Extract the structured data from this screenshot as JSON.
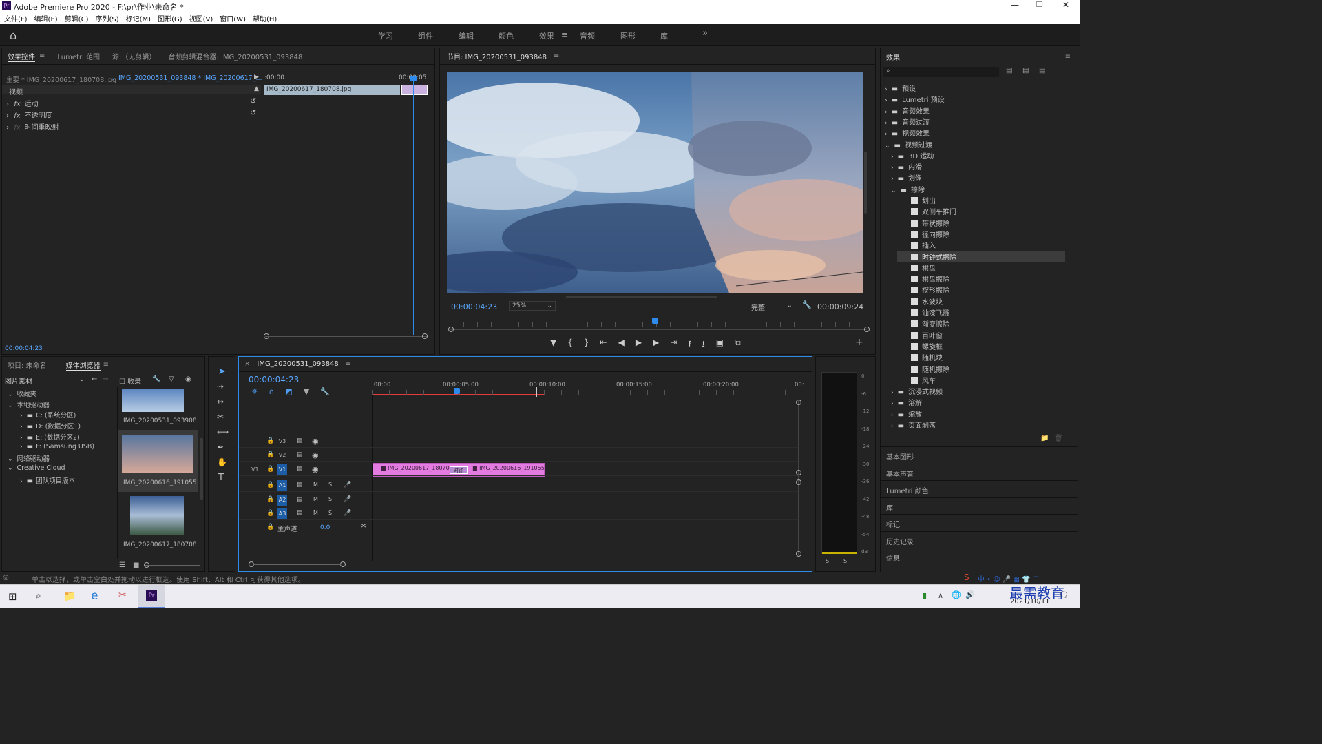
{
  "window": {
    "title": "Adobe Premiere Pro 2020 - F:\\pr\\作业\\未命名 *",
    "app_icon": "Pr"
  },
  "menu": [
    "文件(F)",
    "编辑(E)",
    "剪辑(C)",
    "序列(S)",
    "标记(M)",
    "图形(G)",
    "视图(V)",
    "窗口(W)",
    "帮助(H)"
  ],
  "workspaces": [
    "学习",
    "组件",
    "编辑",
    "颜色",
    "效果",
    "音频",
    "图形",
    "库"
  ],
  "workspace_active": "效果",
  "effect_controls": {
    "tabs": [
      "效果控件",
      "Lumetri 范围",
      "源:（无剪辑）",
      "音频剪辑混合器: IMG_20200531_093848"
    ],
    "master": "主要 * IMG_20200617_180708.jpg",
    "sequence": "IMG_20200531_093848 * IMG_20200617_...",
    "video_label": "视频",
    "items": [
      "运动",
      "不透明度",
      "时间重映射"
    ],
    "time_start": ":00:00",
    "time_end": "00:00:05",
    "clip": "IMG_20200617_180708.jpg",
    "timecode": "00:00:04:23"
  },
  "program": {
    "title": "节目: IMG_20200531_093848",
    "timecode": "00:00:04:23",
    "zoom": "25%",
    "quality": "完整",
    "duration": "00:00:09:24"
  },
  "effects": {
    "title": "效果",
    "tree": [
      {
        "label": "预设",
        "level": 0,
        "type": "folder-special"
      },
      {
        "label": "Lumetri 预设",
        "level": 0,
        "type": "folder-special"
      },
      {
        "label": "音频效果",
        "level": 0,
        "type": "folder"
      },
      {
        "label": "音频过渡",
        "level": 0,
        "type": "folder"
      },
      {
        "label": "视频效果",
        "level": 0,
        "type": "folder"
      },
      {
        "label": "视频过渡",
        "level": 0,
        "type": "folder",
        "open": true
      },
      {
        "label": "3D 运动",
        "level": 1,
        "type": "folder"
      },
      {
        "label": "内滑",
        "level": 1,
        "type": "folder"
      },
      {
        "label": "划像",
        "level": 1,
        "type": "folder"
      },
      {
        "label": "擦除",
        "level": 1,
        "type": "folder",
        "open": true
      },
      {
        "label": "划出",
        "level": 2,
        "type": "fx"
      },
      {
        "label": "双侧平推门",
        "level": 2,
        "type": "fx"
      },
      {
        "label": "带状擦除",
        "level": 2,
        "type": "fx"
      },
      {
        "label": "径向擦除",
        "level": 2,
        "type": "fx"
      },
      {
        "label": "插入",
        "level": 2,
        "type": "fx"
      },
      {
        "label": "时钟式擦除",
        "level": 2,
        "type": "fx",
        "selected": true
      },
      {
        "label": "棋盘",
        "level": 2,
        "type": "fx"
      },
      {
        "label": "棋盘擦除",
        "level": 2,
        "type": "fx"
      },
      {
        "label": "楔形擦除",
        "level": 2,
        "type": "fx"
      },
      {
        "label": "水波块",
        "level": 2,
        "type": "fx"
      },
      {
        "label": "油漆飞溅",
        "level": 2,
        "type": "fx"
      },
      {
        "label": "渐变擦除",
        "level": 2,
        "type": "fx"
      },
      {
        "label": "百叶窗",
        "level": 2,
        "type": "fx"
      },
      {
        "label": "螺旋框",
        "level": 2,
        "type": "fx"
      },
      {
        "label": "随机块",
        "level": 2,
        "type": "fx"
      },
      {
        "label": "随机擦除",
        "level": 2,
        "type": "fx"
      },
      {
        "label": "风车",
        "level": 2,
        "type": "fx"
      },
      {
        "label": "沉浸式视频",
        "level": 1,
        "type": "folder"
      },
      {
        "label": "溶解",
        "level": 1,
        "type": "folder"
      },
      {
        "label": "缩放",
        "level": 1,
        "type": "folder"
      },
      {
        "label": "页面剥落",
        "level": 1,
        "type": "folder"
      }
    ],
    "side_panels": [
      "基本图形",
      "基本声音",
      "Lumetri 颜色",
      "库",
      "标记",
      "历史记录",
      "信息"
    ]
  },
  "project": {
    "tabs": [
      "项目: 未命名",
      "媒体浏览器"
    ],
    "filter": "图片素材",
    "ingest": "收录",
    "tree": [
      {
        "label": "收藏夹",
        "level": 0
      },
      {
        "label": "本地驱动器",
        "level": 0
      },
      {
        "label": "C: (系统分区)",
        "level": 1
      },
      {
        "label": "D: (数据分区1)",
        "level": 1
      },
      {
        "label": "E: (数据分区2)",
        "level": 1
      },
      {
        "label": "F: (Samsung USB)",
        "level": 1
      },
      {
        "label": "网络驱动器",
        "level": 0
      },
      {
        "label": "Creative Cloud",
        "level": 0
      },
      {
        "label": "团队项目版本",
        "level": 1
      }
    ],
    "thumbs": [
      "IMG_20200531_093908",
      "IMG_20200616_191055",
      "IMG_20200617_180708"
    ]
  },
  "timeline": {
    "tab": "IMG_20200531_093848",
    "timecode": "00:00:04:23",
    "ruler": [
      ":00:00",
      "00:00:05:00",
      "00:00:10:00",
      "00:00:15:00",
      "00:00:20:00",
      "00:"
    ],
    "tracks": [
      "V3",
      "V2",
      "V1",
      "A1",
      "A2",
      "A3"
    ],
    "master": "主声道",
    "master_val": "0.0",
    "clips": [
      "IMG_20200617_180708.j",
      "IMG_20200616_191055.j"
    ],
    "transition": "时钟"
  },
  "meter": {
    "scale": [
      "0",
      "-6",
      "-12",
      "-18",
      "-24",
      "-30",
      "-36",
      "-42",
      "-48",
      "-54",
      "dB"
    ],
    "solo": [
      "S",
      "S"
    ]
  },
  "status_text": "单击以选择，或单击空白处并拖动以进行框选。使用 Shift、Alt 和 Ctrl 可获得其他选项。",
  "taskbar": {
    "date": "2021/10/11",
    "watermark": "最需教育"
  },
  "colors": {
    "accent": "#2d8ceb",
    "clip": "#e37be0",
    "panel": "#232323"
  }
}
